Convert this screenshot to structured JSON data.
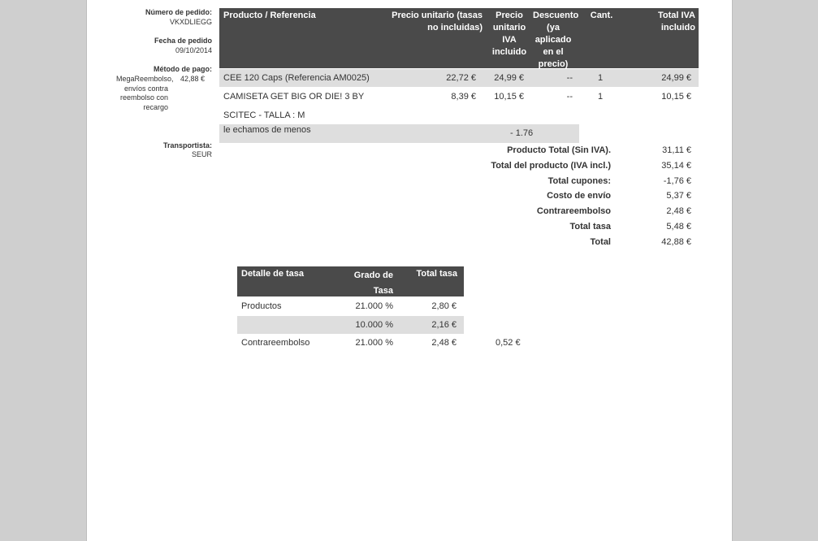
{
  "order": {
    "number_label": "Número de pedido:",
    "number": "VKXDLIEGG",
    "date_label": "Fecha de pedido",
    "date": "09/10/2014",
    "payment_label": "Método de pago:",
    "payment_name": "MegaReembolso, envíos contra reembolso con recargo",
    "payment_amount": "42,88 €",
    "carrier_label": "Transportista:",
    "carrier": "SEUR"
  },
  "products_table": {
    "headers": {
      "product": "Producto / Referencia",
      "unit_price": "Precio unitario (tasas no incluidas)",
      "unit_price_iva": "Precio unitario IVA incluido",
      "discount": "Descuento (ya aplicado en el precio)",
      "qty": "Cant.",
      "total_iva": "Total IVA incluido"
    },
    "rows": [
      {
        "product": "CEE 120 Caps (Referencia AM0025)",
        "unit_price": "22,72 €",
        "unit_price_iva": "24,99 €",
        "discount": "--",
        "qty": "1",
        "total": "24,99 €"
      },
      {
        "product": "CAMISETA GET BIG OR DIE! 3 BY",
        "product_line2": "SCITEC - TALLA : M",
        "unit_price": "8,39 €",
        "unit_price_iva": "10,15 €",
        "discount": "--",
        "qty": "1",
        "total": "10,15 €"
      }
    ],
    "voucher": {
      "name": "le echamos de menos",
      "value": "- 1.76"
    }
  },
  "totals": [
    {
      "label": "Producto Total (Sin IVA).",
      "value": "31,11 €"
    },
    {
      "label": "Total del producto (IVA incl.)",
      "value": "35,14 €"
    },
    {
      "label": "Total cupones:",
      "value": "-1,76 €"
    },
    {
      "label": "Costo de envío",
      "value": "5,37 €"
    },
    {
      "label": "Contrareembolso",
      "value": "2,48 €"
    },
    {
      "label": "Total tasa",
      "value": "5,48 €"
    },
    {
      "label": "Total",
      "value": "42,88 €"
    }
  ],
  "tax_table": {
    "headers": {
      "detail": "Detalle de tasa",
      "rate": "Grado de Tasa",
      "total": "Total tasa"
    },
    "rows": [
      {
        "detail": "Productos",
        "rate": "21.000 %",
        "total": "2,80 €",
        "extra": ""
      },
      {
        "detail": "",
        "rate": "10.000 %",
        "total": "2,16 €",
        "extra": ""
      },
      {
        "detail": "Contrareembolso",
        "rate": "21.000 %",
        "total": "2,48 €",
        "extra": "0,52 €"
      }
    ]
  }
}
